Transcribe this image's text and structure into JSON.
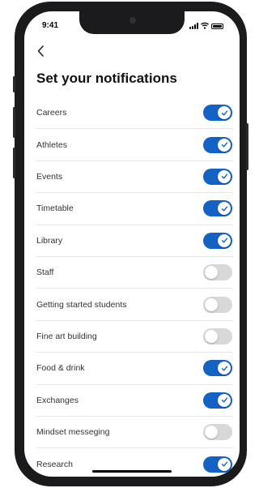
{
  "status_bar": {
    "time": "9:41"
  },
  "page": {
    "title": "Set your notifications"
  },
  "notifications": [
    {
      "label": "Careers",
      "enabled": true
    },
    {
      "label": "Athletes",
      "enabled": true
    },
    {
      "label": "Events",
      "enabled": true
    },
    {
      "label": "Timetable",
      "enabled": true
    },
    {
      "label": "Library",
      "enabled": true
    },
    {
      "label": "Staff",
      "enabled": false
    },
    {
      "label": "Getting started students",
      "enabled": false
    },
    {
      "label": "Fine art building",
      "enabled": false
    },
    {
      "label": "Food & drink",
      "enabled": true
    },
    {
      "label": "Exchanges",
      "enabled": true
    },
    {
      "label": "Mindset messeging",
      "enabled": false
    },
    {
      "label": "Research",
      "enabled": true
    }
  ],
  "colors": {
    "toggle_on": "#1462c4",
    "toggle_off": "#d8d8d8"
  }
}
